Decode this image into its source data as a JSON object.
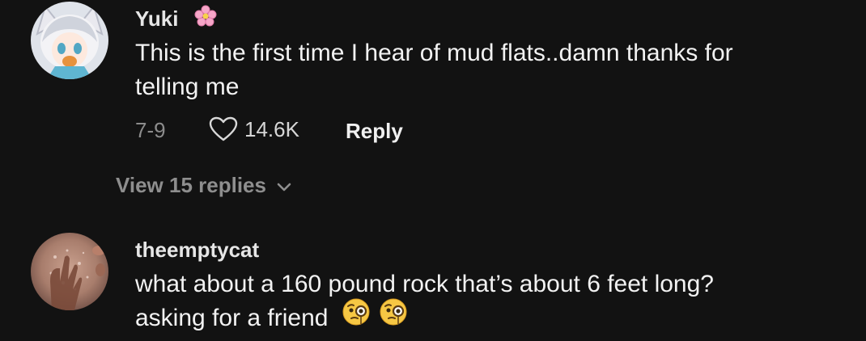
{
  "comments": [
    {
      "username": "Yuki",
      "name_badge_icon": "cherry-blossom-icon",
      "text_line1": "This is the first time I hear of mud flats..damn thanks for",
      "text_line2": "telling me",
      "date": "7-9",
      "like_icon": "heart-outline-icon",
      "likes": "14.6K",
      "reply_label": "Reply",
      "view_replies_label": "View 15 replies",
      "view_replies_icon": "chevron-down-icon"
    },
    {
      "username": "theemptycat",
      "text_line1": "what about a 160 pound rock that’s about 6 feet long?",
      "text_line2": "asking for a friend",
      "trailing_emojis": [
        "face-with-monocle-icon",
        "face-with-monocle-icon"
      ]
    }
  ],
  "colors": {
    "background": "#121212",
    "text_primary": "#f2f2f2",
    "text_secondary": "#8c8c8c",
    "badge_pink": "#f29ac0"
  }
}
